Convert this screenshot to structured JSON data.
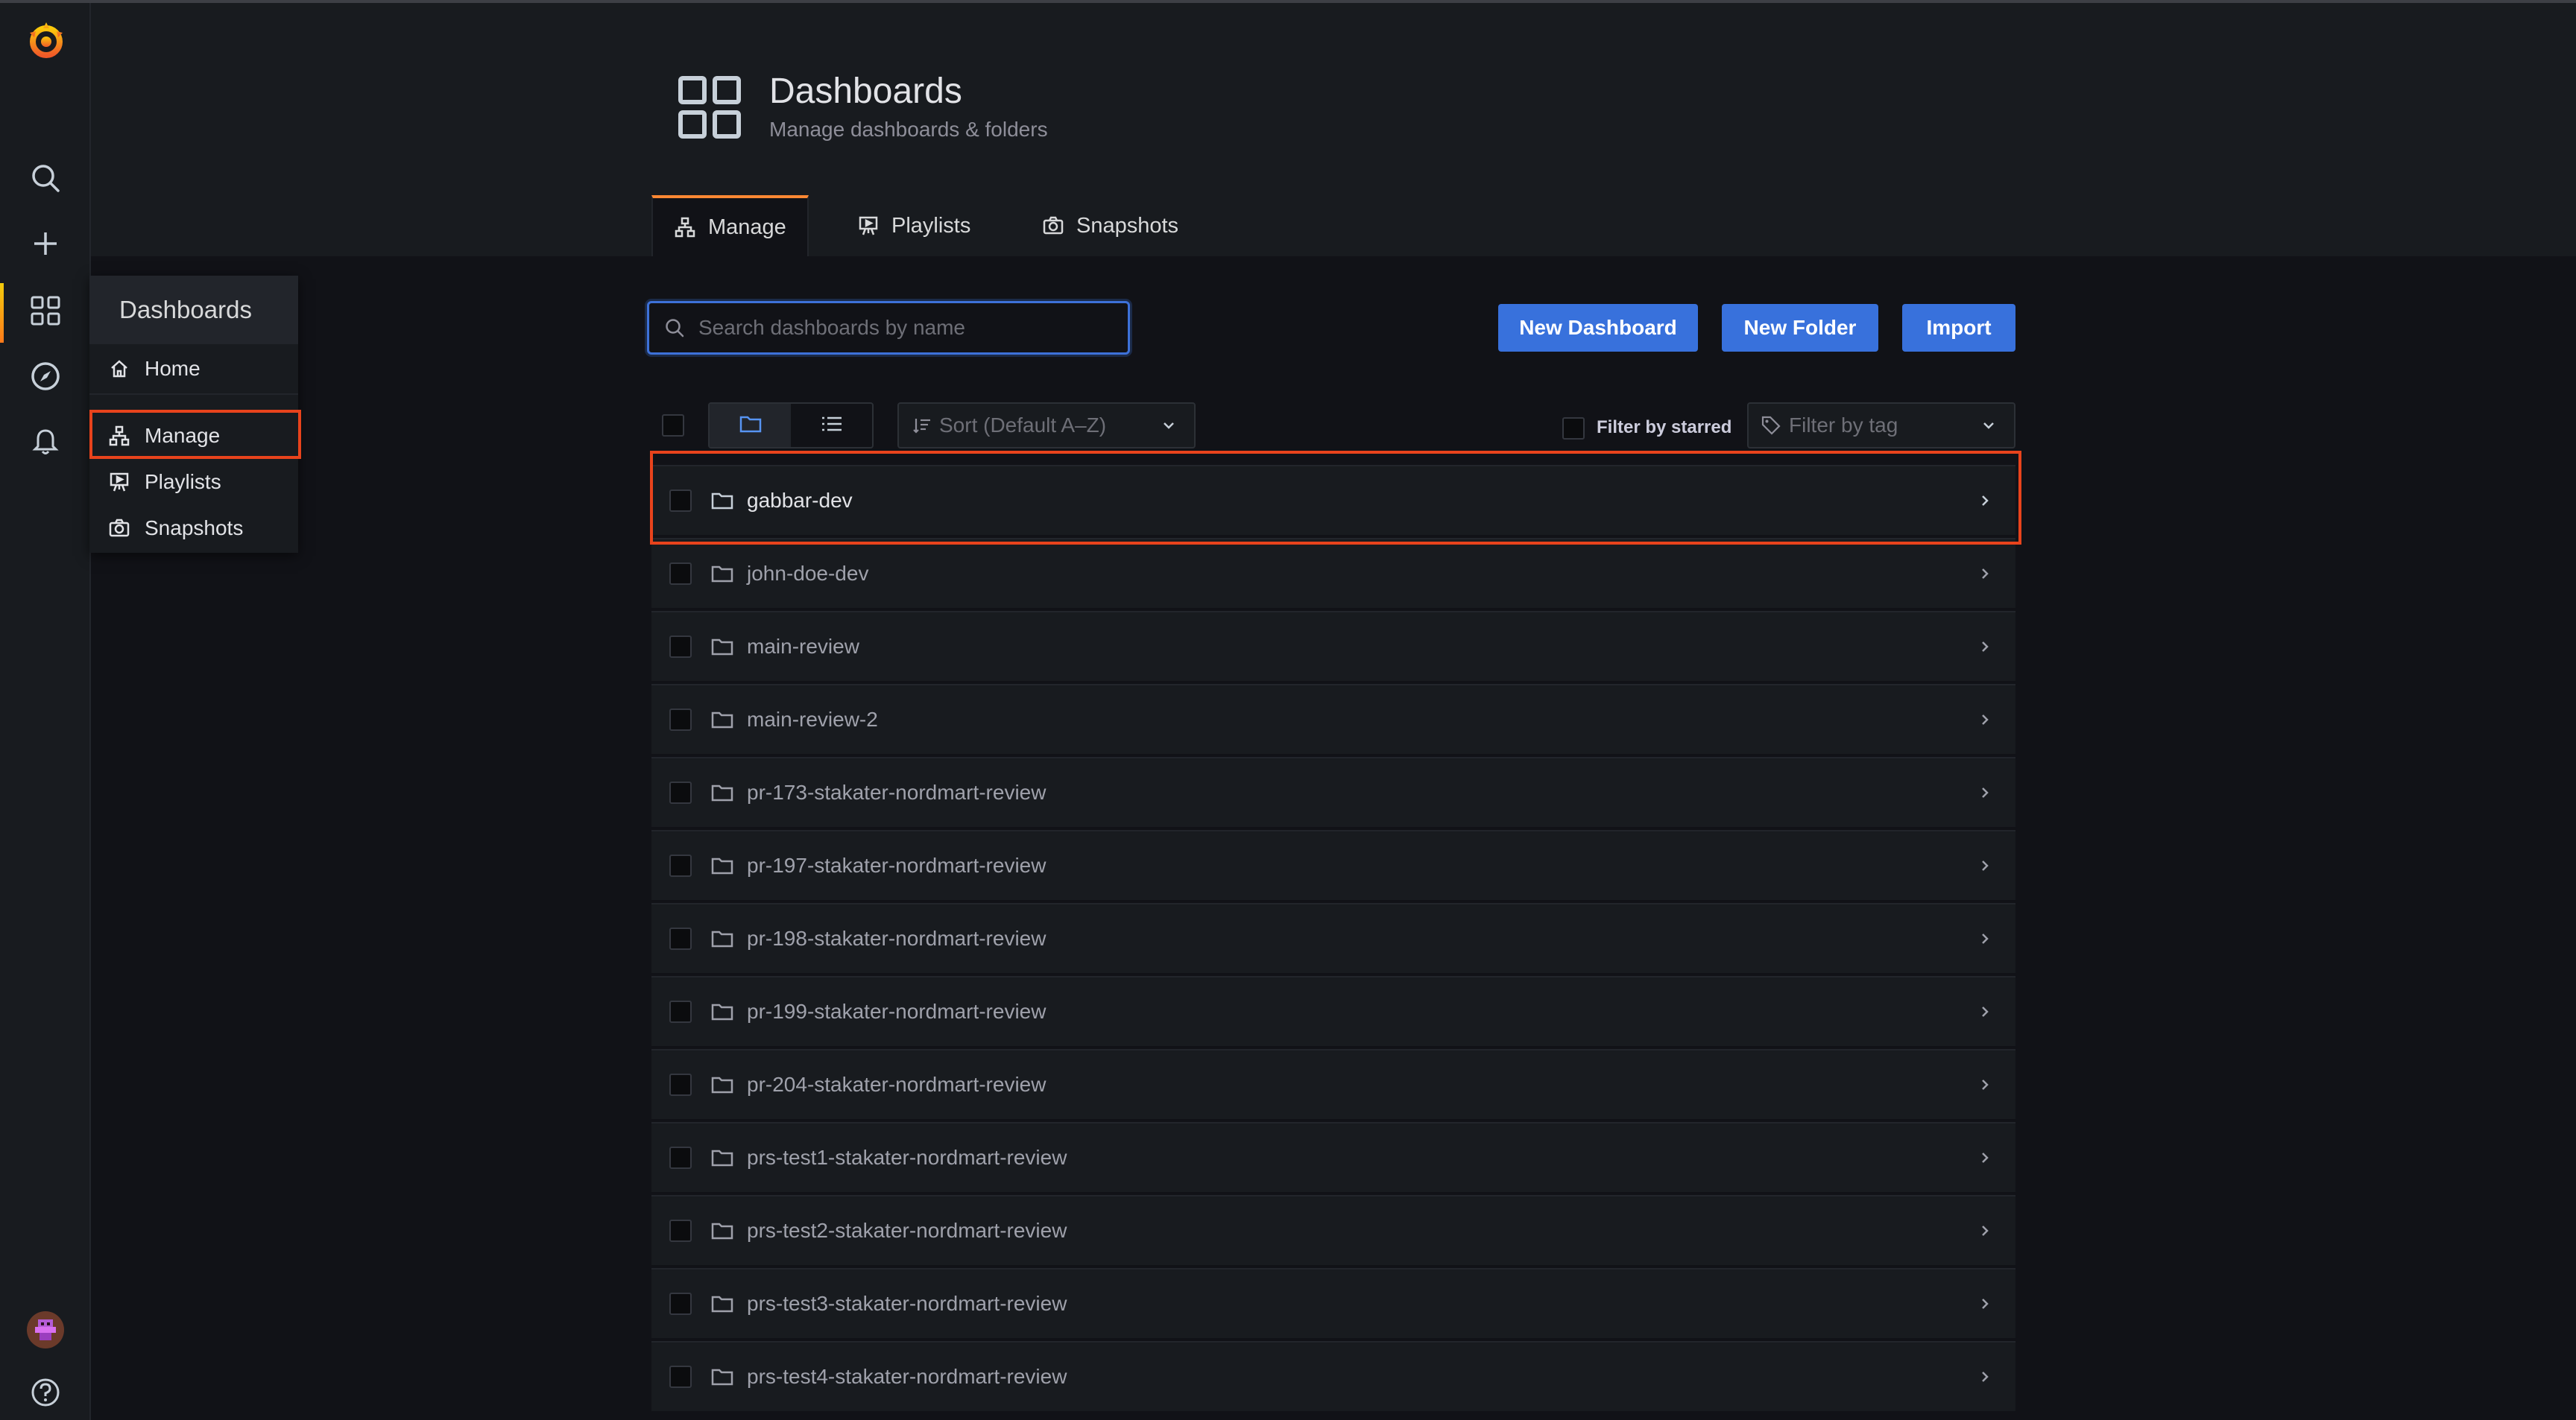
{
  "header": {
    "title": "Dashboards",
    "subtitle": "Manage dashboards & folders"
  },
  "tabs": [
    {
      "label": "Manage",
      "active": true
    },
    {
      "label": "Playlists",
      "active": false
    },
    {
      "label": "Snapshots",
      "active": false
    }
  ],
  "flyout": {
    "title": "Dashboards",
    "items": [
      {
        "label": "Home",
        "icon": "home-icon"
      },
      {
        "label": "Manage",
        "icon": "manage-icon"
      },
      {
        "label": "Playlists",
        "icon": "playlist-icon"
      },
      {
        "label": "Snapshots",
        "icon": "camera-icon"
      }
    ]
  },
  "toolbar": {
    "search_placeholder": "Search dashboards by name",
    "new_dashboard": "New Dashboard",
    "new_folder": "New Folder",
    "import": "Import",
    "sort_label": "Sort (Default A–Z)",
    "filter_starred": "Filter by starred",
    "filter_tag_placeholder": "Filter by tag"
  },
  "folders": [
    "gabbar-dev",
    "john-doe-dev",
    "main-review",
    "main-review-2",
    "pr-173-stakater-nordmart-review",
    "pr-197-stakater-nordmart-review",
    "pr-198-stakater-nordmart-review",
    "pr-199-stakater-nordmart-review",
    "pr-204-stakater-nordmart-review",
    "prs-test1-stakater-nordmart-review",
    "prs-test2-stakater-nordmart-review",
    "prs-test3-stakater-nordmart-review",
    "prs-test4-stakater-nordmart-review"
  ],
  "colors": {
    "accent": "#3871dc",
    "highlight": "#e8431c",
    "background": "#111217"
  }
}
